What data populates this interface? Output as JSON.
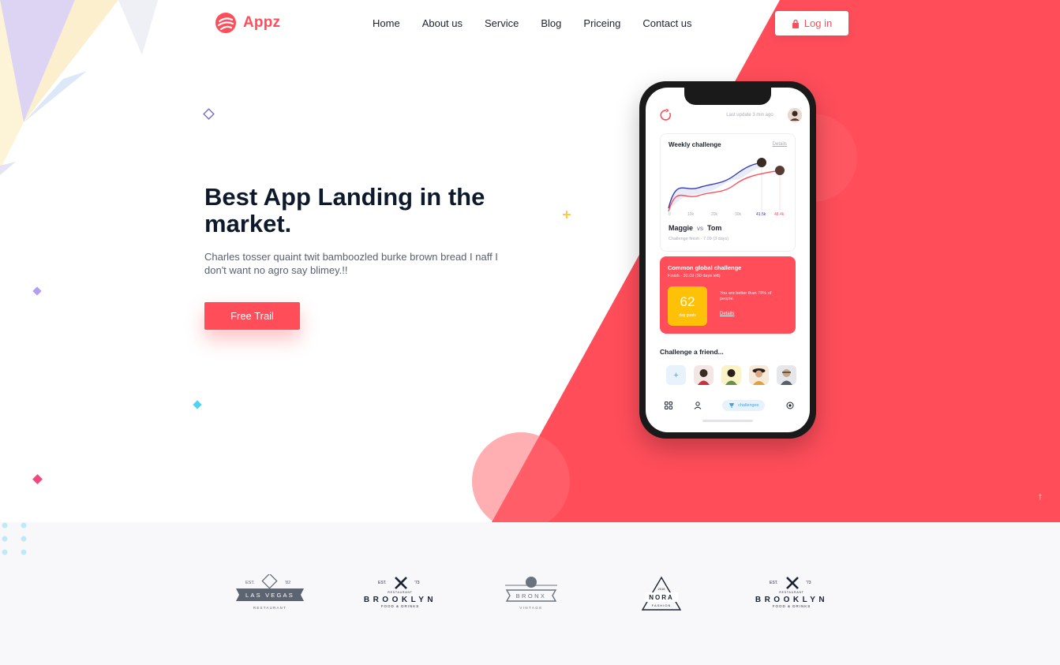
{
  "brand": {
    "name": "Appz",
    "logo_icon": "appz-logo-icon",
    "color": "#ff4d5a"
  },
  "nav": {
    "items": [
      {
        "label": "Home"
      },
      {
        "label": "About us"
      },
      {
        "label": "Service"
      },
      {
        "label": "Blog"
      },
      {
        "label": "Priceing"
      },
      {
        "label": "Contact us"
      }
    ],
    "login": {
      "label": "Log in",
      "icon": "lock-icon"
    }
  },
  "hero": {
    "title": "Best App Landing in the market.",
    "description": "Charles tosser quaint twit bamboozled burke brown bread I naff I don't want no agro say blimey.!!",
    "cta": "Free Trail"
  },
  "app": {
    "last_update": "Last update 3 min ago",
    "weekly": {
      "title": "Weekly challenge",
      "details": "Details",
      "x_ticks": [
        "0",
        "10k",
        "20k",
        "30k"
      ],
      "value_a": "41.5k",
      "value_b": "48.4k",
      "player_a": "Maggie",
      "vs": "vs",
      "player_b": "Tom",
      "subtitle": "Challenge finish - 7.09 (3 days)"
    },
    "global": {
      "title": "Common global challenge",
      "subtitle": "Finish - 30.09 (30 days left)",
      "score": "62",
      "score_label": "day goals",
      "text": "You are better than 78% of people.",
      "link": "Details"
    },
    "friends": {
      "title": "Challenge a friend...",
      "add": "+"
    },
    "tabbar": {
      "active_label": "challenges"
    }
  },
  "scroll_top": "↑",
  "partners": [
    {
      "name": "las-vegas-logo",
      "est": "EST.",
      "year": "'82",
      "title": "LAS VEGAS",
      "sub": "RESTAURANT"
    },
    {
      "name": "brooklyn-logo-1",
      "est": "EST.",
      "year": "'73",
      "top": "RESTAURANT",
      "title": "BROOKLYN",
      "sub": "FOOD & DRINKS"
    },
    {
      "name": "bronx-logo",
      "title": "BRONX",
      "sub": "VINTAGE"
    },
    {
      "name": "nora-logo",
      "top": "2016",
      "title": "NORA",
      "sub": "FASHION"
    },
    {
      "name": "brooklyn-logo-2",
      "est": "EST.",
      "year": "'73",
      "top": "RESTAURANT",
      "title": "BROOKLYN",
      "sub": "FOOD & DRINKS"
    }
  ],
  "colors": {
    "accent": "#ff4d5a",
    "dark": "#0e1a2b",
    "score": "#ffc107",
    "blue": "#2f3ab4"
  }
}
